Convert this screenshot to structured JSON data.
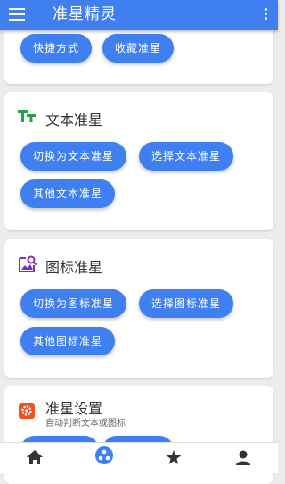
{
  "app": {
    "title": "准星精灵"
  },
  "top_card": {
    "buttons": [
      "快捷方式",
      "收藏准星"
    ]
  },
  "text_card": {
    "title": "文本准星",
    "buttons": [
      "切换为文本准星",
      "选择文本准星",
      "其他文本准星"
    ]
  },
  "image_card": {
    "title": "图标准星",
    "buttons": [
      "切换为图标准星",
      "选择图标准星",
      "其他图标准星"
    ]
  },
  "settings_card": {
    "title": "准星设置",
    "subtitle": "自动判断文本或图标"
  },
  "bottom_nav": {
    "items": [
      {
        "icon": "home-icon",
        "active": false
      },
      {
        "icon": "crosshair-icon",
        "active": true
      },
      {
        "icon": "star-icon",
        "active": false
      },
      {
        "icon": "person-icon",
        "active": false
      }
    ]
  },
  "colors": {
    "primary": "#3f7ff0",
    "text_icon": "#1ea34a",
    "image_icon": "#7b2fbe",
    "settings_icon": "#f4511e"
  }
}
